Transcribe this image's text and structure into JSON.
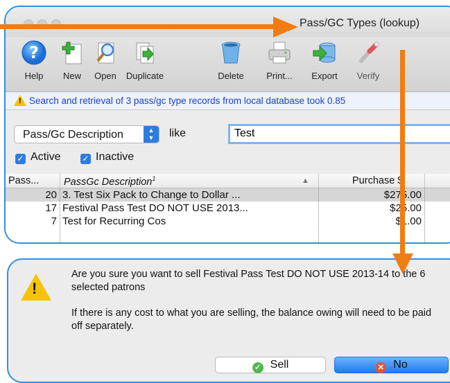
{
  "window": {
    "title": "Pass/GC Types (lookup)"
  },
  "toolbar": {
    "items": [
      {
        "label": "Help",
        "icon": "help-icon"
      },
      {
        "label": "New",
        "icon": "new-icon"
      },
      {
        "label": "Open",
        "icon": "open-icon"
      },
      {
        "label": "Duplicate",
        "icon": "duplicate-icon"
      },
      {
        "label": "Delete",
        "icon": "delete-icon"
      },
      {
        "label": "Print...",
        "icon": "print-icon"
      },
      {
        "label": "Export",
        "icon": "export-icon"
      },
      {
        "label": "Verify",
        "icon": "verify-icon"
      }
    ]
  },
  "status": {
    "text": "Search and retrieval of 3 pass/gc type records from local database took 0.85"
  },
  "search": {
    "field": "Pass/Gc Description",
    "operator": "like",
    "value": "Test"
  },
  "filters": {
    "active_label": "Active",
    "active_checked": true,
    "inactive_label": "Inactive",
    "inactive_checked": true
  },
  "table": {
    "headers": [
      "Pass...",
      "PassGc Description",
      "1",
      "Purchase $"
    ],
    "rows": [
      {
        "id": "20",
        "desc": "3. Test Six Pack to Change to Dollar ...",
        "price": "$275.00"
      },
      {
        "id": "17",
        "desc": "Festival Pass Test DO NOT USE 2013...",
        "price": "$25.00"
      },
      {
        "id": "7",
        "desc": "Test for Recurring Cos",
        "price": "$1.00"
      }
    ]
  },
  "dialog": {
    "message": "Are you sure you want to sell Festival Pass Test DO NOT USE 2013-14 to the 6 selected patrons",
    "note": "If there is any cost to what you are selling, the balance owing will need to be paid off separately.",
    "sell_label": "Sell",
    "no_label": "No"
  },
  "colors": {
    "accent": "#2d7de0",
    "callout": "#2f8fe6",
    "arrow": "#f07d12",
    "status_text": "#1a3fd6"
  }
}
